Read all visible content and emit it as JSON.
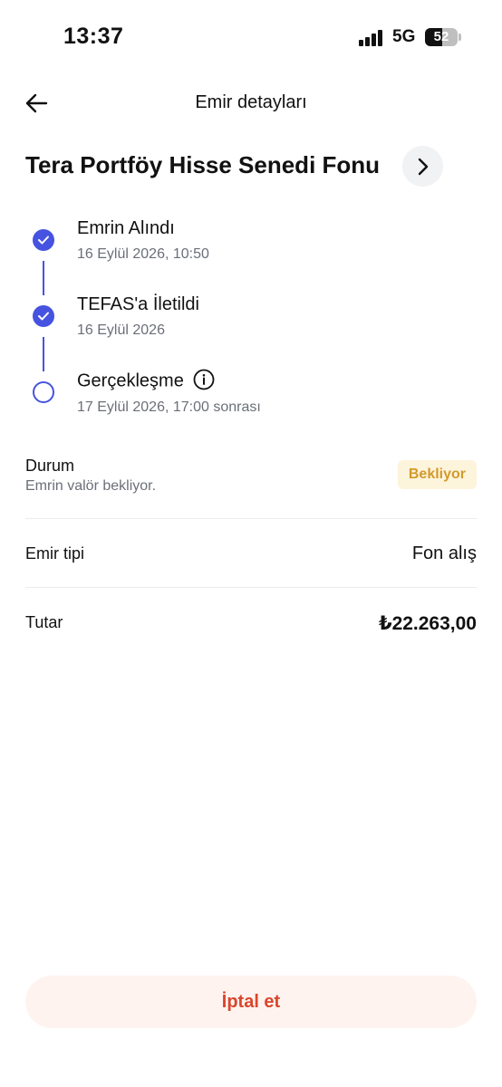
{
  "status_bar": {
    "time": "13:37",
    "network": "5G",
    "battery_level": "52",
    "battery_percent": 52
  },
  "header": {
    "title": "Emir detayları",
    "back_icon": "arrow-left-icon"
  },
  "fund": {
    "name": "Tera Portföy Hisse Senedi Fonu",
    "detail_icon": "chevron-right-icon"
  },
  "timeline": {
    "steps": [
      {
        "title": "Emrin Alındı",
        "date": "16 Eylül 2026, 10:50",
        "state": "done"
      },
      {
        "title": "TEFAS'a İletildi",
        "date": "16 Eylül 2026",
        "state": "done"
      },
      {
        "title": "Gerçekleşme",
        "date": "17 Eylül 2026, 17:00 sonrası",
        "state": "pending",
        "icon": "info-icon"
      }
    ]
  },
  "details": {
    "status": {
      "label": "Durum",
      "description": "Emrin valör bekliyor.",
      "badge": "Bekliyor"
    },
    "order_type": {
      "label": "Emir tipi",
      "value": "Fon alış"
    },
    "amount": {
      "label": "Tutar",
      "value": "₺22.263,00"
    }
  },
  "actions": {
    "cancel_label": "İptal et"
  },
  "colors": {
    "accent": "#4653e0",
    "badge_bg": "#fdf4dc",
    "badge_text": "#d39a2c",
    "cancel_bg": "#fff3f0",
    "cancel_text": "#d9472b"
  }
}
